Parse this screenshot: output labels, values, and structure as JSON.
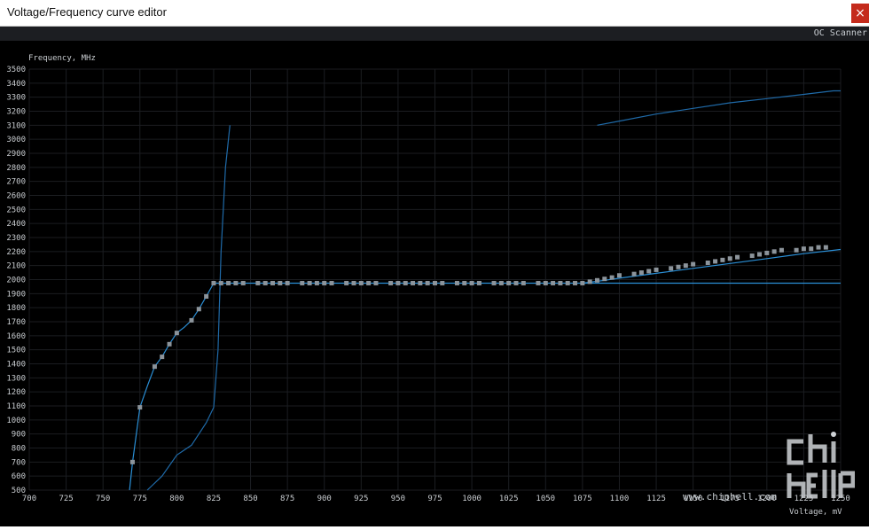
{
  "window": {
    "title": "Voltage/Frequency curve editor",
    "close_glyph": "×"
  },
  "toolbar": {
    "oc_scanner_label": "OC Scanner"
  },
  "watermark": {
    "site": "www.chiphell.com"
  },
  "colors": {
    "curve": "#2a8fd6",
    "points": "#8c949b",
    "grid": "#1b1d21",
    "reference": "#1f6aa8"
  },
  "chart_data": {
    "type": "line",
    "xlabel": "Voltage, mV",
    "ylabel": "Frequency, MHz",
    "xlim": [
      700,
      1250
    ],
    "ylim": [
      500,
      3500
    ],
    "x_ticks": [
      700,
      725,
      750,
      775,
      800,
      825,
      850,
      875,
      900,
      925,
      950,
      975,
      1000,
      1025,
      1050,
      1075,
      1100,
      1125,
      1150,
      1175,
      1200,
      1225,
      1250
    ],
    "x_tick_labels": [
      "700",
      "725",
      "750",
      "775",
      "800",
      "825",
      "850",
      "875",
      "900",
      "925",
      "950",
      "975",
      "1000",
      "1025",
      "1050",
      "1075",
      "1100",
      "1125",
      "1150",
      "1175",
      "1200",
      "1225",
      "1250"
    ],
    "y_ticks": [
      500,
      600,
      700,
      800,
      900,
      1000,
      1100,
      1200,
      1300,
      1400,
      1500,
      1600,
      1700,
      1800,
      1900,
      2000,
      2100,
      2200,
      2300,
      2400,
      2500,
      2600,
      2700,
      2800,
      2900,
      3000,
      3100,
      3200,
      3300,
      3400,
      3500
    ],
    "grid": true,
    "series": [
      {
        "kind": "active-curve",
        "x": [
          768,
          770,
          775,
          780,
          785,
          790,
          795,
          800,
          805,
          810,
          815,
          820,
          825,
          1250
        ],
        "y": [
          500,
          700,
          1090,
          1240,
          1380,
          1450,
          1540,
          1620,
          1660,
          1710,
          1790,
          1880,
          1975,
          1975
        ]
      },
      {
        "kind": "active-curve-tail",
        "x": [
          1075,
          1090,
          1100,
          1125,
          1150,
          1175,
          1200,
          1225,
          1250
        ],
        "y": [
          1975,
          1995,
          2010,
          2045,
          2080,
          2115,
          2150,
          2185,
          2215
        ]
      },
      {
        "kind": "points",
        "x": [
          770,
          775,
          785,
          790,
          795,
          800,
          810,
          815,
          820,
          825,
          830,
          835,
          840,
          845,
          855,
          860,
          865,
          870,
          875,
          885,
          890,
          895,
          900,
          905,
          915,
          920,
          925,
          930,
          935,
          945,
          950,
          955,
          960,
          965,
          970,
          975,
          980,
          990,
          995,
          1000,
          1005,
          1015,
          1020,
          1025,
          1030,
          1035,
          1045,
          1050,
          1055,
          1060,
          1065,
          1070,
          1075,
          1080,
          1085,
          1090,
          1095,
          1100,
          1110,
          1115,
          1120,
          1125,
          1135,
          1140,
          1145,
          1150,
          1160,
          1165,
          1170,
          1175,
          1180,
          1190,
          1195,
          1200,
          1205,
          1210,
          1220,
          1225,
          1230,
          1235,
          1240
        ],
        "y": [
          700,
          1090,
          1380,
          1450,
          1540,
          1620,
          1710,
          1790,
          1880,
          1975,
          1975,
          1975,
          1975,
          1975,
          1975,
          1975,
          1975,
          1975,
          1975,
          1975,
          1975,
          1975,
          1975,
          1975,
          1975,
          1975,
          1975,
          1975,
          1975,
          1975,
          1975,
          1975,
          1975,
          1975,
          1975,
          1975,
          1975,
          1975,
          1975,
          1975,
          1975,
          1975,
          1975,
          1975,
          1975,
          1975,
          1975,
          1975,
          1975,
          1975,
          1975,
          1975,
          1975,
          1985,
          1995,
          2005,
          2015,
          2030,
          2040,
          2050,
          2060,
          2070,
          2080,
          2090,
          2100,
          2110,
          2120,
          2130,
          2140,
          2150,
          2160,
          2170,
          2180,
          2190,
          2200,
          2210,
          2210,
          2220,
          2220,
          2230,
          2230
        ]
      },
      {
        "kind": "reference-curve",
        "x": [
          780,
          790,
          800,
          810,
          820,
          825,
          828,
          830,
          833,
          836
        ],
        "y": [
          500,
          600,
          750,
          820,
          980,
          1090,
          1500,
          2200,
          2800,
          3100
        ]
      },
      {
        "kind": "reference-curve-upper",
        "x": [
          1085,
          1100,
          1125,
          1150,
          1175,
          1200,
          1225,
          1245,
          1250
        ],
        "y": [
          3100,
          3130,
          3180,
          3220,
          3260,
          3290,
          3320,
          3345,
          3345
        ]
      }
    ]
  }
}
